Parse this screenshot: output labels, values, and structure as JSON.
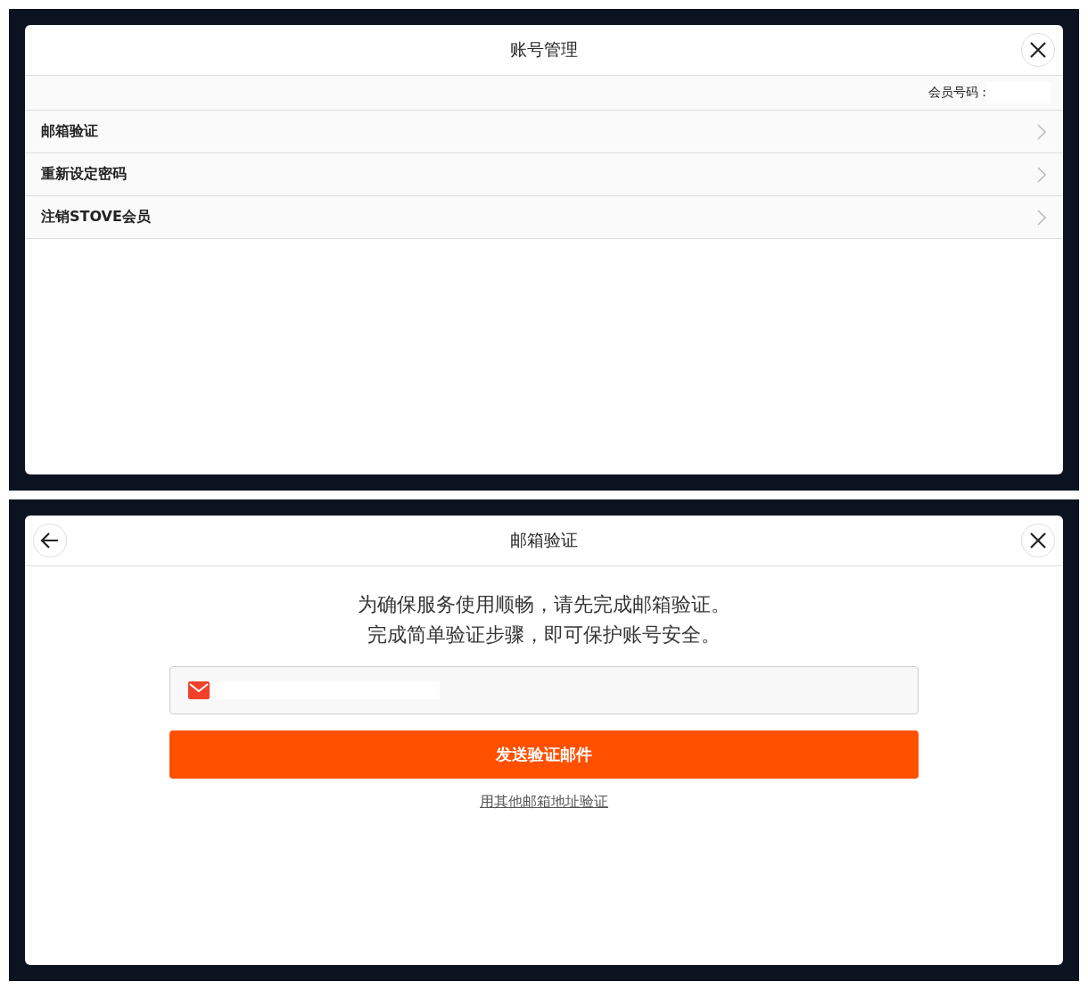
{
  "account_dialog": {
    "title": "账号管理",
    "member_label": "会员号码 :",
    "menu_items": [
      {
        "label": "邮箱验证"
      },
      {
        "label": "重新设定密码"
      },
      {
        "label": "注销STOVE会员"
      }
    ]
  },
  "email_dialog": {
    "title": "邮箱验证",
    "message": [
      "为确保服务使用顺畅，请先完成邮箱验证。",
      "完成简单验证步骤，即可保护账号安全。"
    ],
    "send_button": "发送验证邮件",
    "other_email_link": "用其他邮箱地址验证"
  }
}
